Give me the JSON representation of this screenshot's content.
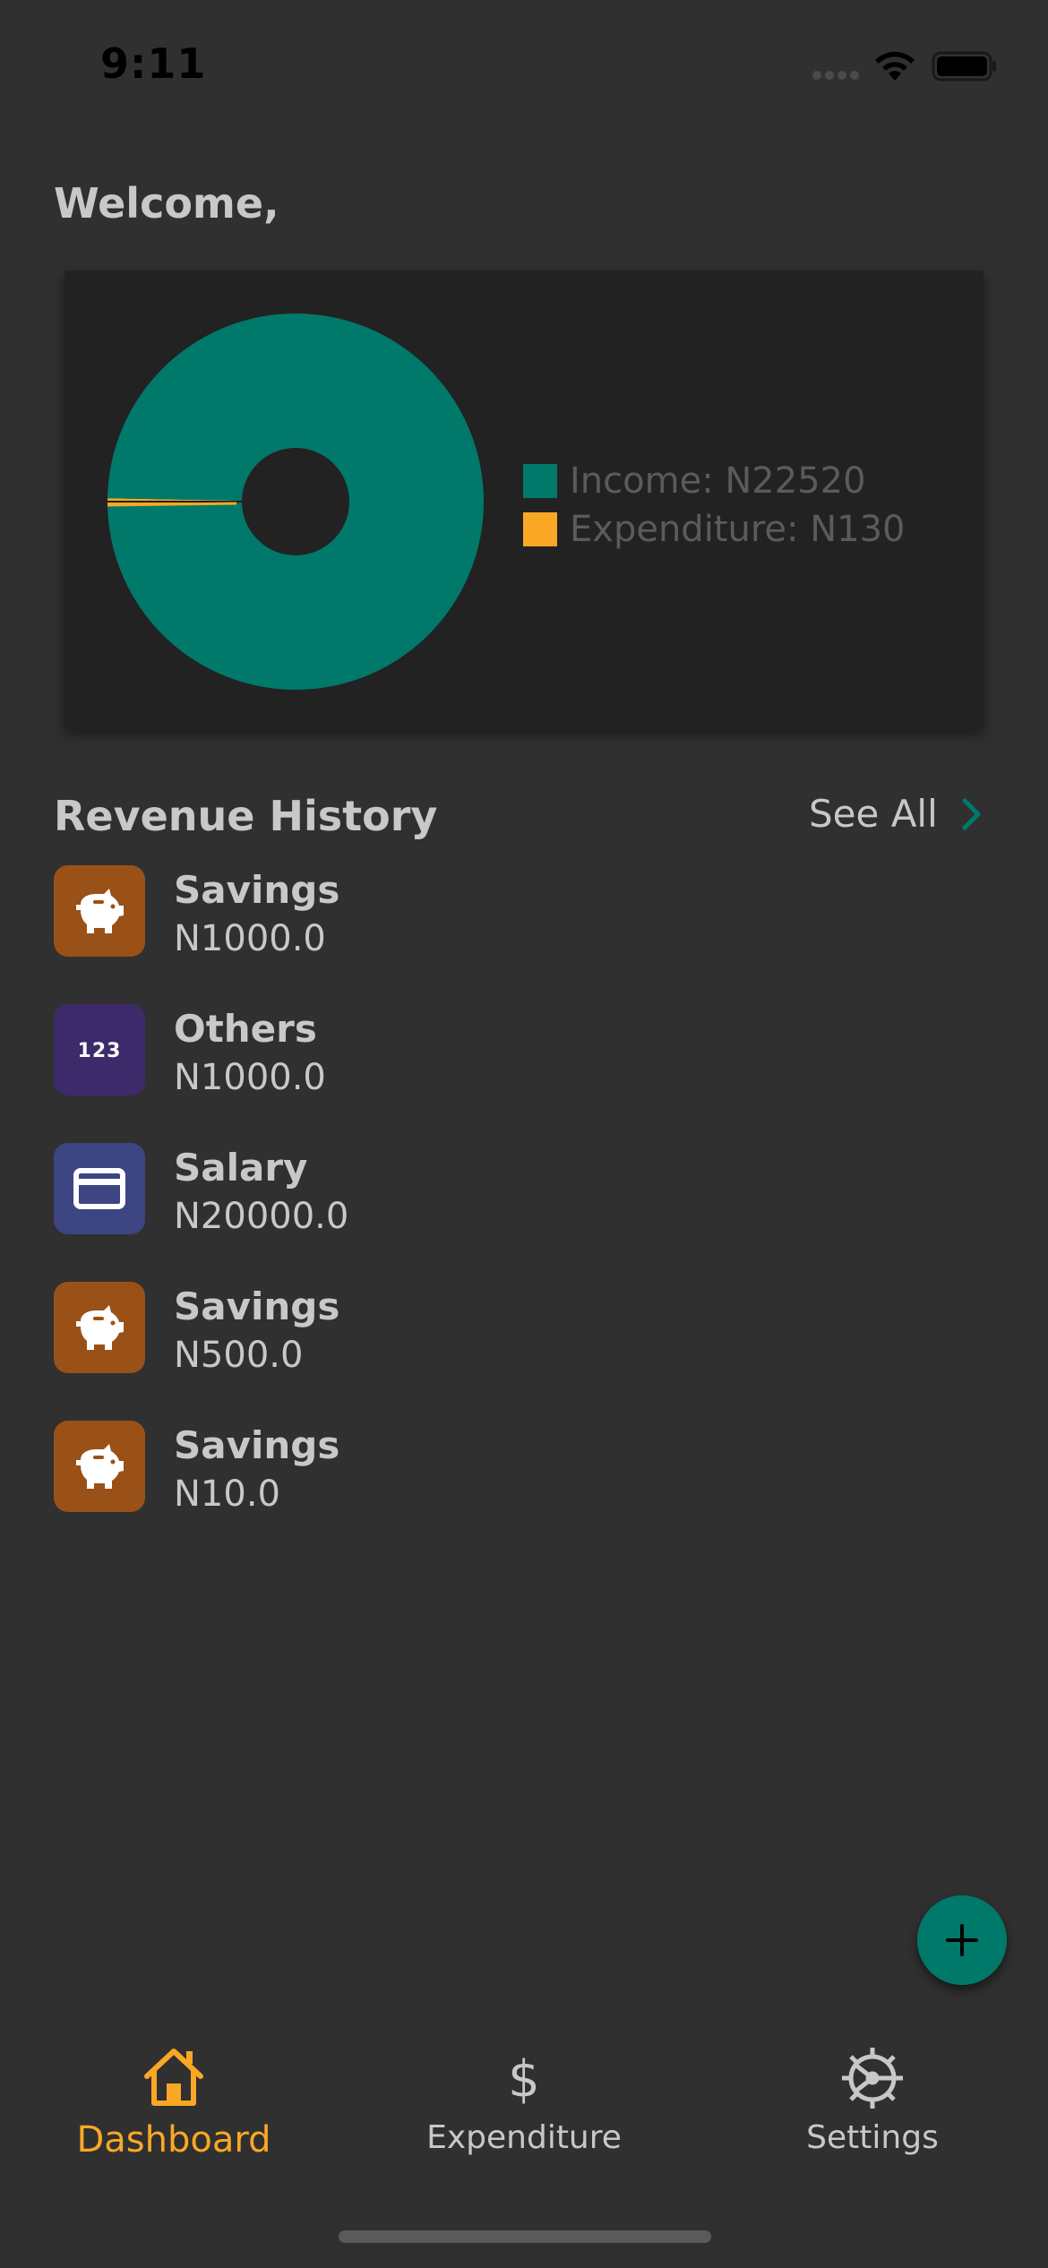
{
  "status_bar": {
    "time": "9:11"
  },
  "greeting": "Welcome,",
  "chart_data": {
    "type": "pie",
    "donut": true,
    "categories": [
      "Income",
      "Expenditure"
    ],
    "values": [
      22520,
      130
    ],
    "colors": [
      "#00796b",
      "#f9a825"
    ],
    "legend": [
      "Income: N22520",
      "Expenditure: N130"
    ],
    "legend_position": "right"
  },
  "revenue_history": {
    "title": "Revenue History",
    "see_all_label": "See All",
    "items": [
      {
        "title": "Savings",
        "amount": "N1000.0",
        "icon": "piggy-bank-icon",
        "color": "#9a5118"
      },
      {
        "title": "Others",
        "amount": "N1000.0",
        "icon": "numbers-123-icon",
        "color": "#3d2a6a"
      },
      {
        "title": "Salary",
        "amount": "N20000.0",
        "icon": "credit-card-icon",
        "color": "#3e4583"
      },
      {
        "title": "Savings",
        "amount": "N500.0",
        "icon": "piggy-bank-icon",
        "color": "#9a5118"
      },
      {
        "title": "Savings",
        "amount": "N10.0",
        "icon": "piggy-bank-icon",
        "color": "#9a5118"
      }
    ]
  },
  "fab": {
    "icon": "plus-icon",
    "color": "#00796b"
  },
  "bottom_nav": {
    "items": [
      {
        "label": "Dashboard",
        "icon": "home-icon",
        "active": true
      },
      {
        "label": "Expenditure",
        "icon": "dollar-icon",
        "active": false
      },
      {
        "label": "Settings",
        "icon": "gear-icon",
        "active": false
      }
    ],
    "active_color": "#f9a825"
  }
}
